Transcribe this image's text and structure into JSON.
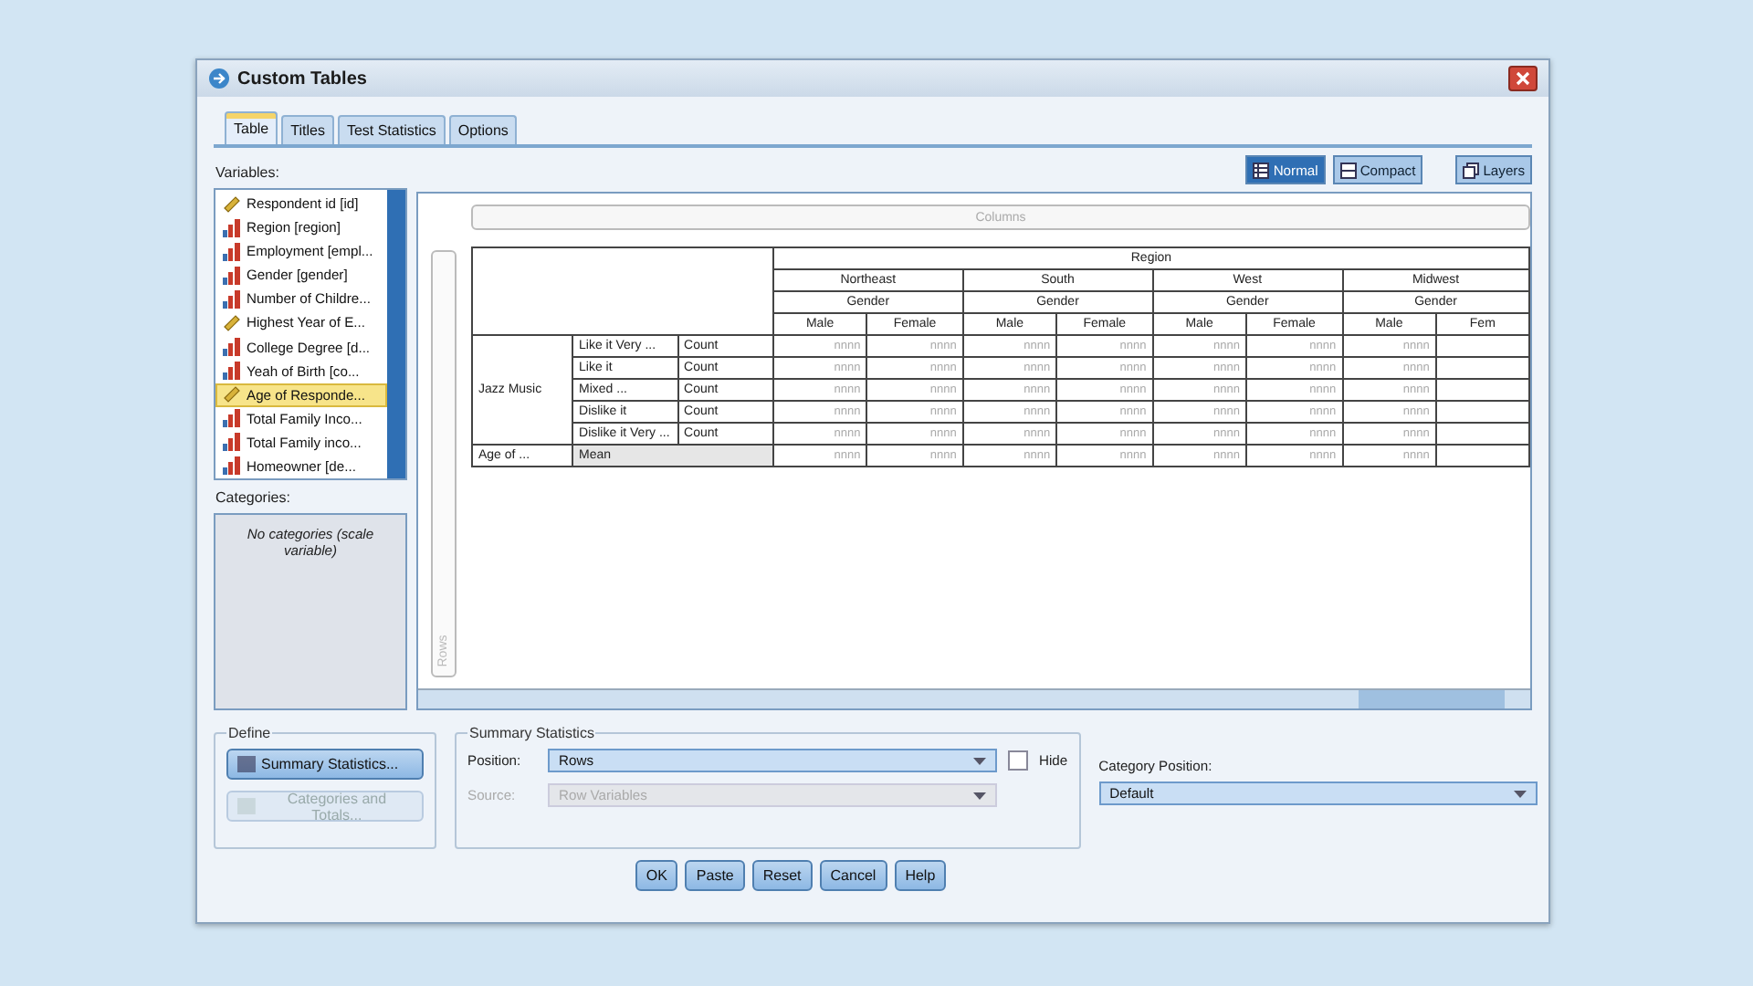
{
  "window": {
    "title": "Custom Tables"
  },
  "tabs": [
    {
      "label": "Table",
      "selected": true
    },
    {
      "label": "Titles",
      "selected": false
    },
    {
      "label": "Test Statistics",
      "selected": false
    },
    {
      "label": "Options",
      "selected": false
    }
  ],
  "variables": {
    "label": "Variables:",
    "items": [
      {
        "name": "Respondent id [id]",
        "kind": "scale",
        "selected": false
      },
      {
        "name": "Region [region]",
        "kind": "nominal",
        "selected": false
      },
      {
        "name": "Employment [empl...",
        "kind": "nominal",
        "selected": false
      },
      {
        "name": "Gender [gender]",
        "kind": "nominal",
        "selected": false
      },
      {
        "name": "Number of Childre...",
        "kind": "nominal",
        "selected": false
      },
      {
        "name": "Highest Year of E...",
        "kind": "scale",
        "selected": false
      },
      {
        "name": "College Degree [d...",
        "kind": "nominal",
        "selected": false
      },
      {
        "name": "Yeah of Birth [co...",
        "kind": "nominal",
        "selected": false
      },
      {
        "name": "Age of Responde...",
        "kind": "scale",
        "selected": true
      },
      {
        "name": "Total Family Inco...",
        "kind": "nominal",
        "selected": false
      },
      {
        "name": "Total Family inco...",
        "kind": "nominal",
        "selected": false
      },
      {
        "name": "Homeowner [de...",
        "kind": "nominal",
        "selected": false
      }
    ]
  },
  "categories": {
    "label": "Categories:",
    "message": "No categories (scale variable)"
  },
  "view_buttons": [
    {
      "label": "Normal",
      "selected": true
    },
    {
      "label": "Compact",
      "selected": false
    }
  ],
  "layers_button": "Layers",
  "table": {
    "columns_zone": "Columns",
    "rows_zone": "Rows",
    "top_header": "Region",
    "regions": [
      {
        "name": "Northeast",
        "sub": "Gender",
        "columns": [
          "Male",
          "Female"
        ]
      },
      {
        "name": "South",
        "sub": "Gender",
        "columns": [
          "Male",
          "Female"
        ]
      },
      {
        "name": "West",
        "sub": "Gender",
        "columns": [
          "Male",
          "Female"
        ]
      },
      {
        "name": "Midwest",
        "sub": "Gender",
        "columns": [
          "Male",
          "Fem"
        ]
      }
    ],
    "row_groups": [
      {
        "label": "Jazz Music",
        "kind": "categorical",
        "rows": [
          {
            "category": "Like it Very ...",
            "statistic": "Count",
            "cells": [
              "nnnn",
              "nnnn",
              "nnnn",
              "nnnn",
              "nnnn",
              "nnnn",
              "nnnn"
            ]
          },
          {
            "category": "Like it",
            "statistic": "Count",
            "cells": [
              "nnnn",
              "nnnn",
              "nnnn",
              "nnnn",
              "nnnn",
              "nnnn",
              "nnnn"
            ]
          },
          {
            "category": "Mixed ...",
            "statistic": "Count",
            "cells": [
              "nnnn",
              "nnnn",
              "nnnn",
              "nnnn",
              "nnnn",
              "nnnn",
              "nnnn"
            ]
          },
          {
            "category": "Dislike it",
            "statistic": "Count",
            "cells": [
              "nnnn",
              "nnnn",
              "nnnn",
              "nnnn",
              "nnnn",
              "nnnn",
              "nnnn"
            ]
          },
          {
            "category": "Dislike it Very ...",
            "statistic": "Count",
            "cells": [
              "nnnn",
              "nnnn",
              "nnnn",
              "nnnn",
              "nnnn",
              "nnnn",
              "nnnn"
            ]
          }
        ]
      },
      {
        "label": "Age of ...",
        "kind": "scale",
        "rows": [
          {
            "statistic": "Mean",
            "cells": [
              "nnnn",
              "nnnn",
              "nnnn",
              "nnnn",
              "nnnn",
              "nnnn",
              "nnnn"
            ]
          }
        ]
      }
    ]
  },
  "define": {
    "title": "Define",
    "buttons": [
      {
        "label": "Summary Statistics...",
        "disabled": false
      },
      {
        "label": "Categories and Totals...",
        "disabled": true
      }
    ]
  },
  "summary_statistics": {
    "title": "Summary Statistics",
    "position": {
      "label": "Position:",
      "value": "Rows",
      "disabled": false
    },
    "hide": {
      "label": "Hide",
      "checked": false
    },
    "source": {
      "label": "Source:",
      "value": "Row Variables",
      "disabled": true
    }
  },
  "category_position": {
    "label": "Category Position:",
    "value": "Default"
  },
  "buttons": [
    "OK",
    "Paste",
    "Reset",
    "Cancel",
    "Help"
  ]
}
